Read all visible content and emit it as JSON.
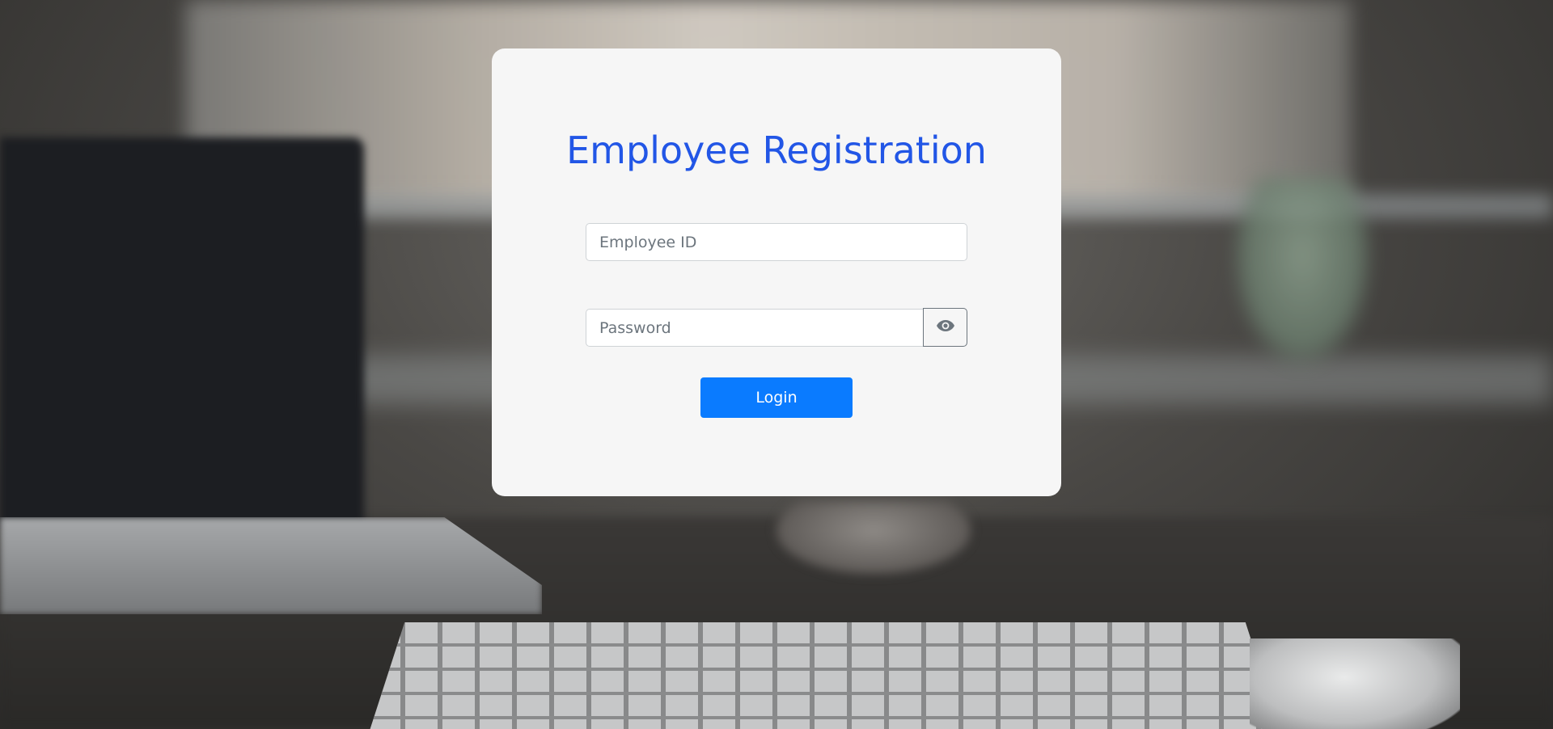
{
  "form": {
    "title": "Employee Registration",
    "employee_id": {
      "placeholder": "Employee ID",
      "value": ""
    },
    "password": {
      "placeholder": "Password",
      "value": ""
    },
    "password_toggle_icon": "eye-icon",
    "login_label": "Login"
  },
  "colors": {
    "title": "#2256e6",
    "primary_button": "#0a7bff",
    "card_background": "#f6f6f6"
  }
}
